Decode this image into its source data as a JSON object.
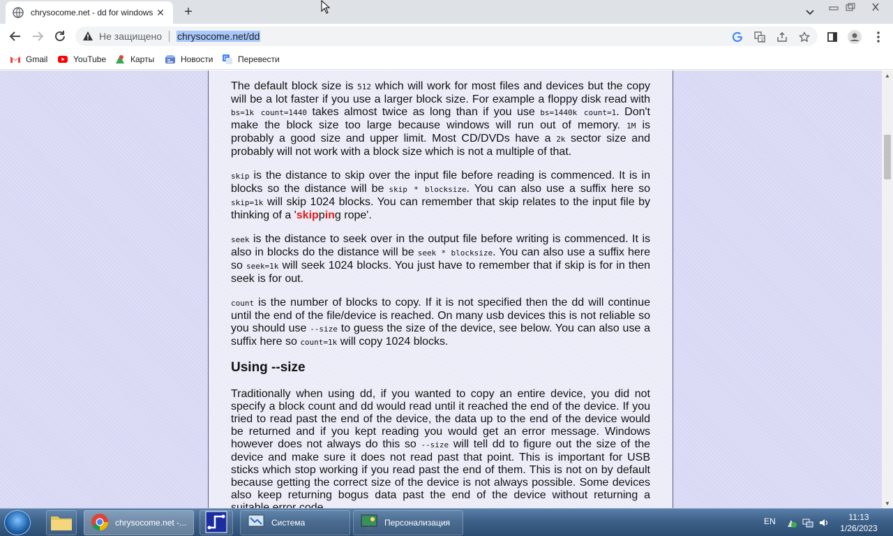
{
  "browser": {
    "tab_title": "chrysocome.net - dd for windows",
    "security_label": "Не защищено",
    "url": "chrysocome.net/dd"
  },
  "bookmarks": [
    {
      "label": "Gmail",
      "icon": "gmail-icon"
    },
    {
      "label": "YouTube",
      "icon": "youtube-icon"
    },
    {
      "label": "Карты",
      "icon": "maps-icon"
    },
    {
      "label": "Новости",
      "icon": "news-icon"
    },
    {
      "label": "Перевести",
      "icon": "translate-icon"
    }
  ],
  "article": {
    "p1": {
      "t1": "The default block size is ",
      "c1": "512",
      "t2": " which will work for most files and devices but the copy will be a lot faster if you use a larger block size. For example a floppy disk read with ",
      "c2": "bs=1k count=1440",
      "t3": " takes almost twice as long than if you use ",
      "c3": "bs=1440k count=1",
      "t4": ". Don't make the block size too large because windows will run out of memory. ",
      "c4": "1M",
      "t5": " is probably a good size and upper limit. Most CD/DVDs have a ",
      "c5": "2k",
      "t6": " sector size and probably will not work with a block size which is not a multiple of that."
    },
    "p2": {
      "c1": "skip",
      "t1": " is the distance to skip over the input file before reading is commenced. It is in blocks so the distance will be ",
      "c2": "skip * blocksize",
      "t2": ". You can also use a suffix here so ",
      "c3": "skip=1k",
      "t3": " will skip 1024 blocks. You can remember that skip relates to the input file by thinking of a '",
      "red1": "skip",
      "mid": "p",
      "red2": "in",
      "t4": "g rope'."
    },
    "p3": {
      "c1": "seek",
      "t1": " is the distance to seek over in the output file before writing is commenced. It is also in blocks do the distance will be ",
      "c2": "seek * blocksize",
      "t2": ". You can also use a suffix here so ",
      "c3": "seek=1k",
      "t3": " will seek 1024 blocks. You just have to remember that if skip is for in then seek is for out."
    },
    "p4": {
      "c1": "count",
      "t1": " is the number of blocks to copy. If it is not specified then the dd will continue until the end of the file/device is reached. On many usb devices this is not reliable so you should use ",
      "c2": "--size",
      "t2": " to guess the size of the device, see below. You can also use a suffix here so ",
      "c3": "count=1k",
      "t3": " will copy 1024 blocks."
    },
    "heading": "Using --size",
    "p5": {
      "t1": "Traditionally when using dd, if you wanted to copy an entire device, you did not specify a block count and dd would read until it reached the end of the device. If you tried to read past the end of the device, the data up to the end of the device would be returned and if you kept reading you would get an error message. Windows however does not always do this so ",
      "c1": "--size",
      "t2": " will tell dd to figure out the size of the device and make sure it does not read past that point. This is important for USB sticks which stop working if you read past the end of them. This is not on by default because getting the correct size of the device is not always possible. Some devices also keep returning bogus data past the end of the device without returning a suitable error code"
    }
  },
  "taskbar": {
    "items": [
      {
        "label": "chrysocome.net -...",
        "icon": "chrome-icon"
      },
      {
        "label": "Система",
        "icon": "system-icon"
      },
      {
        "label": "Персонализация",
        "icon": "personalization-icon"
      }
    ],
    "language": "EN",
    "time": "11:13",
    "date": "1/26/2023"
  },
  "colors": {
    "page_background": "#d8d8f4",
    "content_background": "#ebebf8",
    "highlight_red": "#e0201a",
    "url_selection": "#a8c7fa"
  }
}
